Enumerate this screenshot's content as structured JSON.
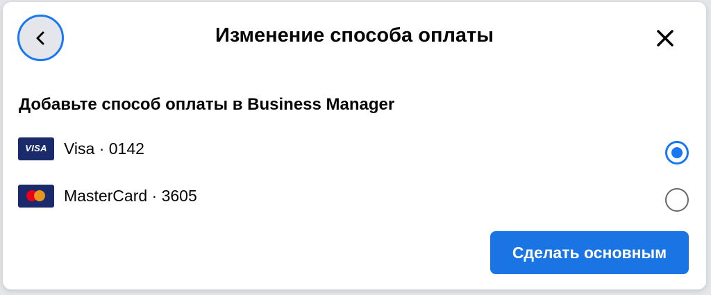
{
  "dialog": {
    "title": "Изменение способа оплаты",
    "back_icon": "chevron-left-icon",
    "close_icon": "close-icon"
  },
  "section": {
    "heading": "Добавьте способ оплаты в Business Manager"
  },
  "payment_methods": [
    {
      "brand": "Visa",
      "logo_text": "VISA",
      "label": "Visa · 0142",
      "selected": true
    },
    {
      "brand": "MasterCard",
      "label": "MasterCard · 3605",
      "selected": false
    }
  ],
  "actions": {
    "primary_label": "Сделать основным"
  },
  "colors": {
    "accent": "#1877f2",
    "button": "#1b74e4",
    "visa_bg": "#1a2a6b",
    "mc_red": "#eb001b",
    "mc_yellow": "#f79e1b"
  }
}
